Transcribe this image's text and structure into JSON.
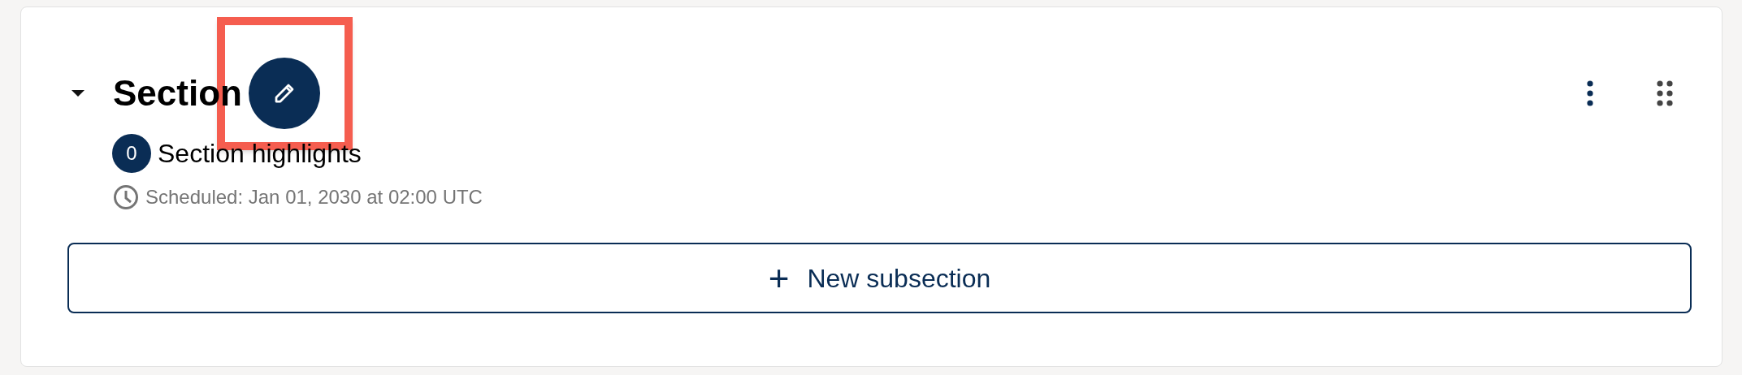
{
  "section": {
    "title": "Section",
    "expanded": true,
    "highlights": {
      "count": "0",
      "label": "Section highlights"
    },
    "schedule": "Scheduled: Jan 01, 2030 at 02:00 UTC",
    "new_button": {
      "icon": "+",
      "label": "New subsection"
    }
  },
  "annotation": {
    "kind": "highlight-frame",
    "color": "#f55d4f"
  }
}
